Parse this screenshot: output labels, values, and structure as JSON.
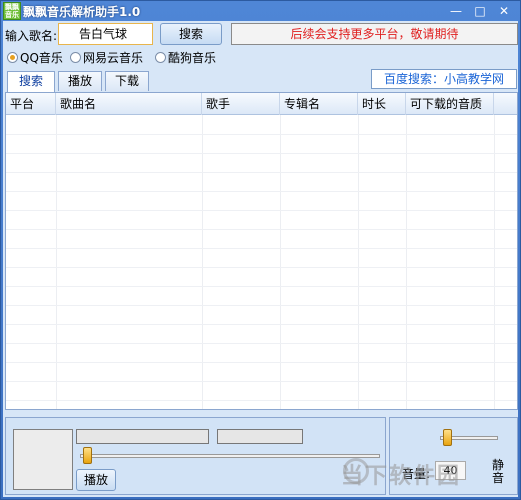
{
  "window": {
    "title": "飘飘音乐解析助手1.0",
    "icon_text": "飘飘音乐",
    "minimize": "—",
    "maximize": "□",
    "close": "✕"
  },
  "search": {
    "label": "输入歌名:",
    "value": "告白气球",
    "button": "搜索",
    "notice": "后续会支持更多平台，敬请期待"
  },
  "platforms": [
    {
      "label": "QQ音乐",
      "selected": true
    },
    {
      "label": "网易云音乐",
      "selected": false
    },
    {
      "label": "酷狗音乐",
      "selected": false
    }
  ],
  "tabs": [
    {
      "label": "搜索",
      "active": true
    },
    {
      "label": "播放",
      "active": false
    },
    {
      "label": "下载",
      "active": false
    }
  ],
  "baidu_link": "百度搜索：小高教学网",
  "table": {
    "columns": [
      "平台",
      "歌曲名",
      "歌手",
      "专辑名",
      "时长",
      "可下载的音质"
    ],
    "rows": []
  },
  "player": {
    "play_button": "播放",
    "volume_label": "音量:",
    "volume_value": "40",
    "mute_label": "静音",
    "seek_position": 0.0,
    "volume_level": 0.4
  },
  "watermark": "当下软件园",
  "colors": {
    "notice_text": "#e02020",
    "link_text": "#1a64d6",
    "title_bar": "#4f86d6"
  }
}
